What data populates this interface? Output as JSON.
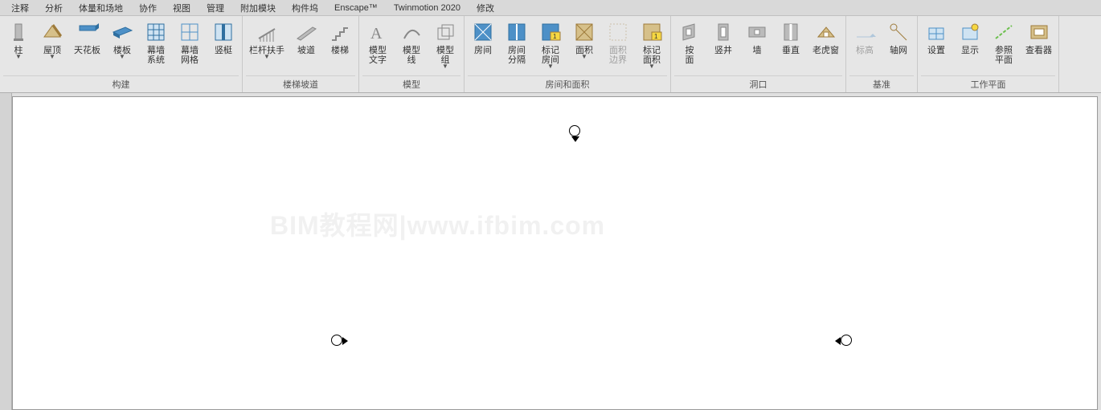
{
  "menu": {
    "items": [
      "注释",
      "分析",
      "体量和场地",
      "协作",
      "视图",
      "管理",
      "附加模块",
      "构件坞",
      "Enscape™",
      "Twinmotion 2020",
      "修改"
    ]
  },
  "ribbon": {
    "panels": [
      {
        "title": "构建",
        "buttons": [
          {
            "id": "column",
            "label": "柱",
            "drop": true,
            "icon": "column"
          },
          {
            "id": "roof",
            "label": "屋顶",
            "drop": true,
            "icon": "roof"
          },
          {
            "id": "ceiling",
            "label": "天花板",
            "icon": "ceiling"
          },
          {
            "id": "floor",
            "label": "楼板",
            "drop": true,
            "icon": "floor"
          },
          {
            "id": "curtain-system",
            "label": "幕墙\n系统",
            "icon": "curtain-system"
          },
          {
            "id": "curtain-grid",
            "label": "幕墙\n网格",
            "icon": "curtain-grid"
          },
          {
            "id": "mullion",
            "label": "竖梃",
            "icon": "mullion"
          }
        ]
      },
      {
        "title": "楼梯坡道",
        "buttons": [
          {
            "id": "railing",
            "label": "栏杆扶手",
            "drop": true,
            "icon": "railing"
          },
          {
            "id": "ramp",
            "label": "坡道",
            "icon": "ramp"
          },
          {
            "id": "stair",
            "label": "楼梯",
            "icon": "stair"
          }
        ]
      },
      {
        "title": "模型",
        "buttons": [
          {
            "id": "model-text",
            "label": "模型\n文字",
            "icon": "model-text"
          },
          {
            "id": "model-line",
            "label": "模型\n线",
            "icon": "model-line"
          },
          {
            "id": "model-group",
            "label": "模型\n组",
            "drop": true,
            "icon": "model-group"
          }
        ]
      },
      {
        "title": "房间和面积",
        "buttons": [
          {
            "id": "room",
            "label": "房间",
            "icon": "room"
          },
          {
            "id": "room-sep",
            "label": "房间\n分隔",
            "icon": "room-sep"
          },
          {
            "id": "tag-room",
            "label": "标记\n房间",
            "drop": true,
            "icon": "tag-room"
          },
          {
            "id": "area",
            "label": "面积",
            "drop": true,
            "icon": "area"
          },
          {
            "id": "area-boundary",
            "label": "面积\n边界",
            "icon": "area-boundary",
            "disabled": true
          },
          {
            "id": "tag-area",
            "label": "标记\n面积",
            "drop": true,
            "icon": "tag-area"
          }
        ]
      },
      {
        "title": "洞口",
        "buttons": [
          {
            "id": "by-face",
            "label": "按\n面",
            "icon": "by-face"
          },
          {
            "id": "shaft",
            "label": "竖井",
            "icon": "shaft"
          },
          {
            "id": "wall-opening",
            "label": "墙",
            "icon": "wall-opening"
          },
          {
            "id": "vertical",
            "label": "垂直",
            "icon": "vertical"
          },
          {
            "id": "dormer",
            "label": "老虎窗",
            "icon": "dormer"
          }
        ]
      },
      {
        "title": "基准",
        "buttons": [
          {
            "id": "level",
            "label": "标高",
            "icon": "level",
            "disabled": true
          },
          {
            "id": "grid",
            "label": "轴网",
            "icon": "grid"
          }
        ]
      },
      {
        "title": "工作平面",
        "buttons": [
          {
            "id": "set",
            "label": "设置",
            "icon": "set"
          },
          {
            "id": "show",
            "label": "显示",
            "icon": "show"
          },
          {
            "id": "ref-plane",
            "label": "参照\n平面",
            "icon": "ref-plane"
          },
          {
            "id": "viewer",
            "label": "查看器",
            "icon": "viewer"
          }
        ]
      }
    ]
  },
  "watermark": "BIM教程网|www.ifbim.com"
}
